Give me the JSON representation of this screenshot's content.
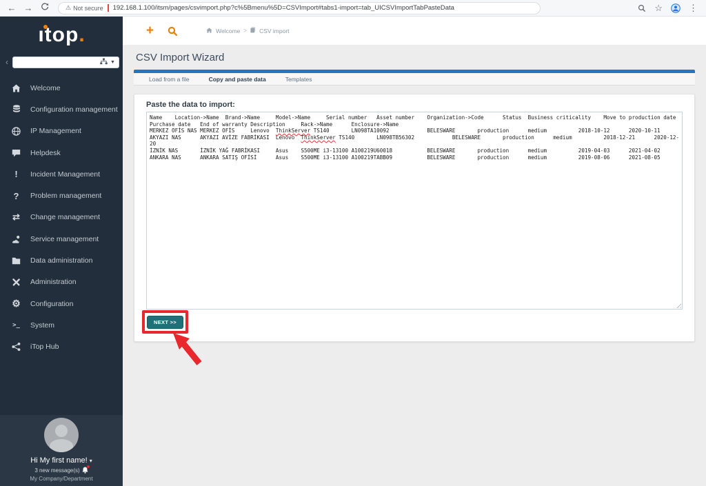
{
  "browser": {
    "back": "←",
    "forward": "→",
    "not_secure": "Not secure",
    "warning_glyph": "⚠",
    "url": "192.168.1.100/itsm/pages/csvimport.php?c%5Bmenu%5D=CSVImport#tabs1-import=tab_UICSVImportTabPasteData",
    "star": "☆",
    "menu_dots": "⋮"
  },
  "sidebar": {
    "logo": {
      "word": "ıtop",
      "dot": "."
    },
    "collapse_glyph": "‹",
    "search": {
      "value": "",
      "placeholder": ""
    },
    "items": [
      {
        "label": "Welcome"
      },
      {
        "label": "Configuration management"
      },
      {
        "label": "IP Management"
      },
      {
        "label": "Helpdesk"
      },
      {
        "label": "Incident Management"
      },
      {
        "label": "Problem management"
      },
      {
        "label": "Change management"
      },
      {
        "label": "Service management"
      },
      {
        "label": "Data administration"
      },
      {
        "label": "Administration"
      },
      {
        "label": "Configuration"
      },
      {
        "label": "System"
      },
      {
        "label": "iTop Hub"
      }
    ],
    "glyphs": {
      "incident": "!",
      "problem": "?",
      "change": "⇄",
      "gear": "⚙",
      "terminal": ">_"
    },
    "user": {
      "greeting": "Hi My first name!",
      "caret": "▾",
      "messages": "3 new message(s)",
      "org": "My Company/Department"
    }
  },
  "topbar": {
    "plus": "+",
    "breadcrumb": {
      "home": "Welcome",
      "sep": ">",
      "page": "CSV import"
    }
  },
  "page": {
    "title": "CSV Import Wizard"
  },
  "tabs": [
    {
      "label": "Load from a file"
    },
    {
      "label": "Copy and paste data"
    },
    {
      "label": "Templates"
    }
  ],
  "import": {
    "label": "Paste the data to import:",
    "next": "NEXT >>",
    "misspelled": [
      "ThinkServer"
    ],
    "lines": [
      "Name    Location->Name  Brand->Name     Model->Name     Serial number   Asset number    Organization->Code      Status  Business criticality    Move to production date",
      "Purchase date   End of warranty Description     Rack->Name      Enclosure->Name",
      "MERKEZ OFİS NAS MERKEZ OFİS     Lenovo  ThinkServer TS140       LN098TA10092            BELESWARE       production      medium          2018-10-12      2020-10-11",
      "AKYAZI NAS      AKYAZI AVİZE FABRİKASI  Lenovo  ThinkServer TS140       LN098TB56302            BELESWARE       production      medium          2018-12-21      2020-12-",
      "20",
      "İZNİK NAS       İZNİK YAĞ FABRİKASI     Asus    S500ME i3-13100 A100219U60018           BELESWARE       production      medium          2019-04-03      2021-04-02",
      "ANKARA NAS      ANKARA SATIŞ OFİSİ      Asus    S500ME i3-13100 A100219TABB09           BELESWARE       production      medium          2019-08-06      2021-08-05"
    ]
  },
  "colors": {
    "accent_orange": "#ee7d00",
    "tab_blue": "#2277c0",
    "button_teal": "#1e7179",
    "annotation_red": "#e8282d",
    "sidebar_bg": "#232e3c"
  }
}
